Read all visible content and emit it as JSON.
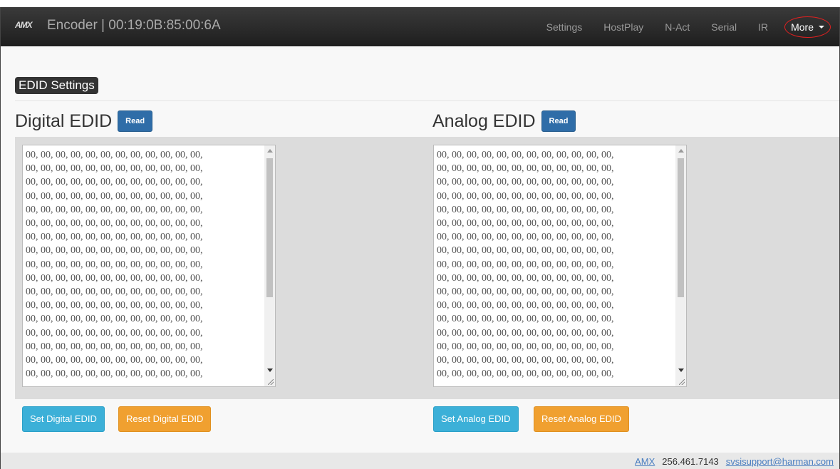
{
  "header": {
    "logo": "AMX",
    "title": "Encoder | 00:19:0B:85:00:6A",
    "nav": [
      "Settings",
      "HostPlay",
      "N-Act",
      "Serial",
      "IR"
    ],
    "more": "More"
  },
  "section": {
    "title": "EDID Settings"
  },
  "digital": {
    "title": "Digital EDID",
    "read": "Read",
    "content": "00, 00, 00, 00, 00, 00, 00, 00, 00, 00, 00, 00,\n00, 00, 00, 00, 00, 00, 00, 00, 00, 00, 00, 00,\n00, 00, 00, 00, 00, 00, 00, 00, 00, 00, 00, 00,\n00, 00, 00, 00, 00, 00, 00, 00, 00, 00, 00, 00,\n00, 00, 00, 00, 00, 00, 00, 00, 00, 00, 00, 00,\n00, 00, 00, 00, 00, 00, 00, 00, 00, 00, 00, 00,\n00, 00, 00, 00, 00, 00, 00, 00, 00, 00, 00, 00,\n00, 00, 00, 00, 00, 00, 00, 00, 00, 00, 00, 00,\n00, 00, 00, 00, 00, 00, 00, 00, 00, 00, 00, 00,\n00, 00, 00, 00, 00, 00, 00, 00, 00, 00, 00, 00,\n00, 00, 00, 00, 00, 00, 00, 00, 00, 00, 00, 00,\n00, 00, 00, 00, 00, 00, 00, 00, 00, 00, 00, 00,\n00, 00, 00, 00, 00, 00, 00, 00, 00, 00, 00, 00,\n00, 00, 00, 00, 00, 00, 00, 00, 00, 00, 00, 00,\n00, 00, 00, 00, 00, 00, 00, 00, 00, 00, 00, 00,\n00, 00, 00, 00, 00, 00, 00, 00, 00, 00, 00, 00,\n00, 00, 00, 00, 00, 00, 00, 00, 00, 00, 00, 00,",
    "set": "Set Digital EDID",
    "reset": "Reset Digital EDID"
  },
  "analog": {
    "title": "Analog EDID",
    "read": "Read",
    "content": "00, 00, 00, 00, 00, 00, 00, 00, 00, 00, 00, 00,\n00, 00, 00, 00, 00, 00, 00, 00, 00, 00, 00, 00,\n00, 00, 00, 00, 00, 00, 00, 00, 00, 00, 00, 00,\n00, 00, 00, 00, 00, 00, 00, 00, 00, 00, 00, 00,\n00, 00, 00, 00, 00, 00, 00, 00, 00, 00, 00, 00,\n00, 00, 00, 00, 00, 00, 00, 00, 00, 00, 00, 00,\n00, 00, 00, 00, 00, 00, 00, 00, 00, 00, 00, 00,\n00, 00, 00, 00, 00, 00, 00, 00, 00, 00, 00, 00,\n00, 00, 00, 00, 00, 00, 00, 00, 00, 00, 00, 00,\n00, 00, 00, 00, 00, 00, 00, 00, 00, 00, 00, 00,\n00, 00, 00, 00, 00, 00, 00, 00, 00, 00, 00, 00,\n00, 00, 00, 00, 00, 00, 00, 00, 00, 00, 00, 00,\n00, 00, 00, 00, 00, 00, 00, 00, 00, 00, 00, 00,\n00, 00, 00, 00, 00, 00, 00, 00, 00, 00, 00, 00,\n00, 00, 00, 00, 00, 00, 00, 00, 00, 00, 00, 00,\n00, 00, 00, 00, 00, 00, 00, 00, 00, 00, 00, 00,\n00, 00, 00, 00, 00, 00, 00, 00, 00, 00, 00, 00,",
    "set": "Set Analog EDID",
    "reset": "Reset Analog EDID"
  },
  "footer": {
    "link1": "AMX",
    "phone": "256.461.7143",
    "email": "svsisupport@harman.com"
  },
  "colors": {
    "navbar": "#2a2a2a",
    "read_button": "#2f6da8",
    "set_button": "#3cb0d8",
    "reset_button": "#f0a030",
    "more_highlight": "#e02020"
  }
}
